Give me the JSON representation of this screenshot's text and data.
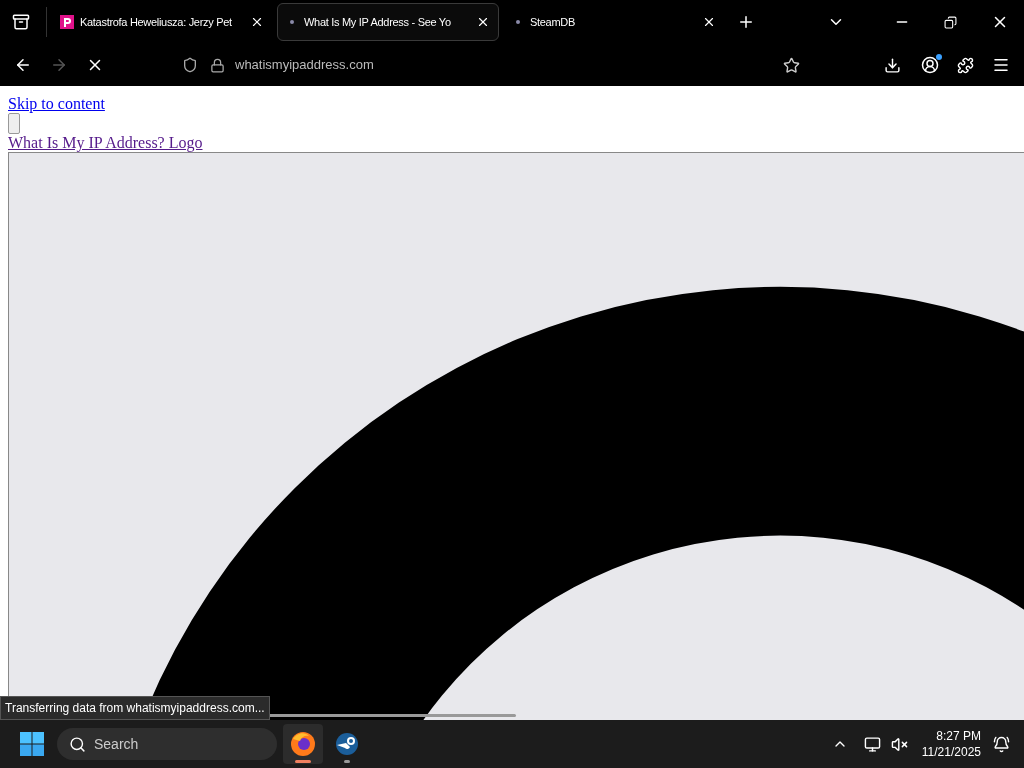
{
  "tabs": [
    {
      "title": "Katastrofa Heweliusza: Jerzy Pet",
      "selected": false,
      "kind": "favicon"
    },
    {
      "title": "What Is My IP Address - See Yo",
      "selected": true,
      "kind": "loading"
    },
    {
      "title": "SteamDB",
      "selected": false,
      "kind": "loading"
    }
  ],
  "toolbar": {
    "url": "whatismyipaddress.com",
    "loading": true,
    "forward_disabled": true
  },
  "page": {
    "skip_link": "Skip to content",
    "logo_link": "What Is My IP Address? Logo"
  },
  "status": "Transferring data from whatismyipaddress.com...",
  "taskbar": {
    "search": {
      "placeholder": "Search"
    },
    "apps": [
      {
        "kind": "firefox",
        "active": true
      },
      {
        "kind": "steam",
        "active": false
      }
    ],
    "time": "8:27 PM",
    "date": "11/21/2025"
  }
}
